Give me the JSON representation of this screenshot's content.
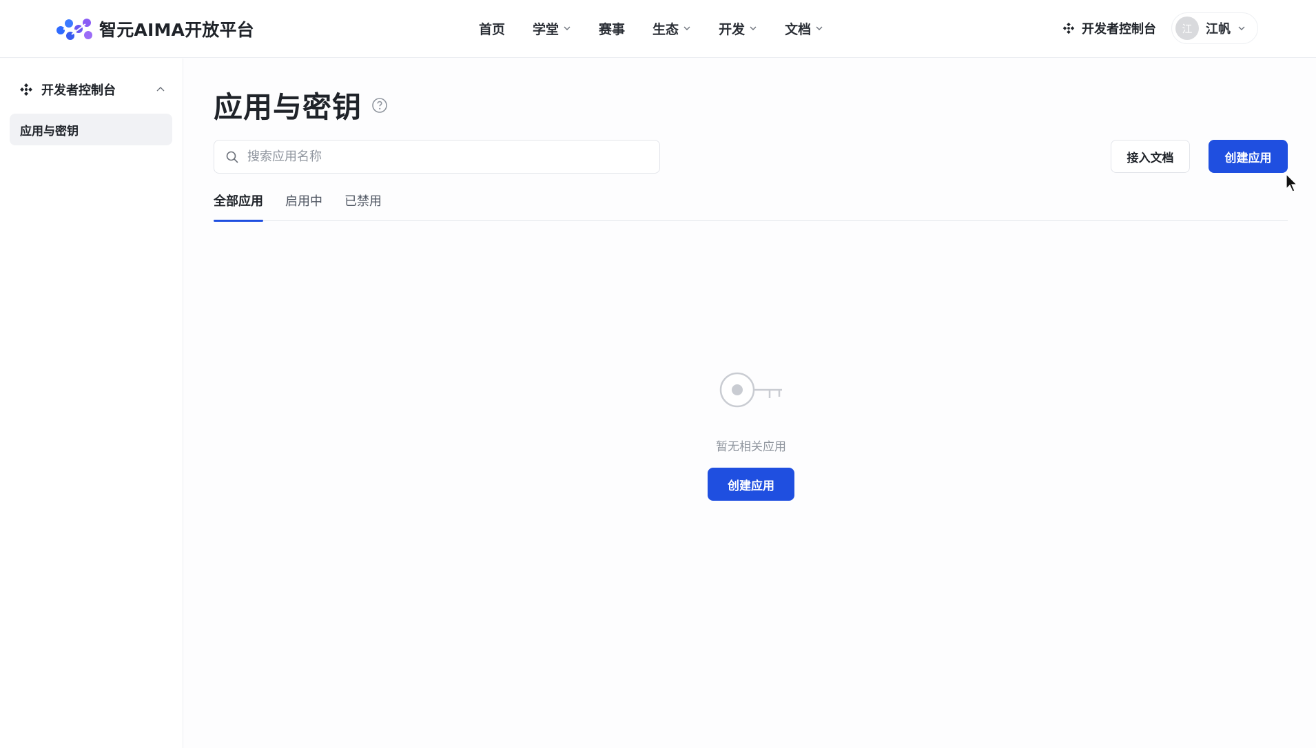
{
  "header": {
    "brand": "智元AIMA开放平台",
    "nav": [
      {
        "label": "首页",
        "has_dropdown": false
      },
      {
        "label": "学堂",
        "has_dropdown": true
      },
      {
        "label": "赛事",
        "has_dropdown": false
      },
      {
        "label": "生态",
        "has_dropdown": true
      },
      {
        "label": "开发",
        "has_dropdown": true
      },
      {
        "label": "文档",
        "has_dropdown": true
      }
    ],
    "console_label": "开发者控制台",
    "user": {
      "avatar_text": "江",
      "name": "江帆"
    }
  },
  "sidebar": {
    "group_label": "开发者控制台",
    "items": [
      {
        "label": "应用与密钥",
        "active": true
      }
    ]
  },
  "main": {
    "title": "应用与密钥",
    "search": {
      "placeholder": "搜索应用名称",
      "value": ""
    },
    "docs_button": "接入文档",
    "create_button": "创建应用",
    "tabs": [
      {
        "label": "全部应用",
        "active": true
      },
      {
        "label": "启用中",
        "active": false
      },
      {
        "label": "已禁用",
        "active": false
      }
    ],
    "empty": {
      "message": "暂无相关应用",
      "button": "创建应用"
    }
  },
  "colors": {
    "primary": "#1f4fe0",
    "text": "#1f2329",
    "muted": "#8f959e",
    "border": "#e3e5ea"
  },
  "icons": [
    "brand-logo-icon",
    "chevron-down-icon",
    "console-icon",
    "chevron-up-icon",
    "help-icon",
    "search-icon",
    "key-icon",
    "cursor-icon"
  ]
}
